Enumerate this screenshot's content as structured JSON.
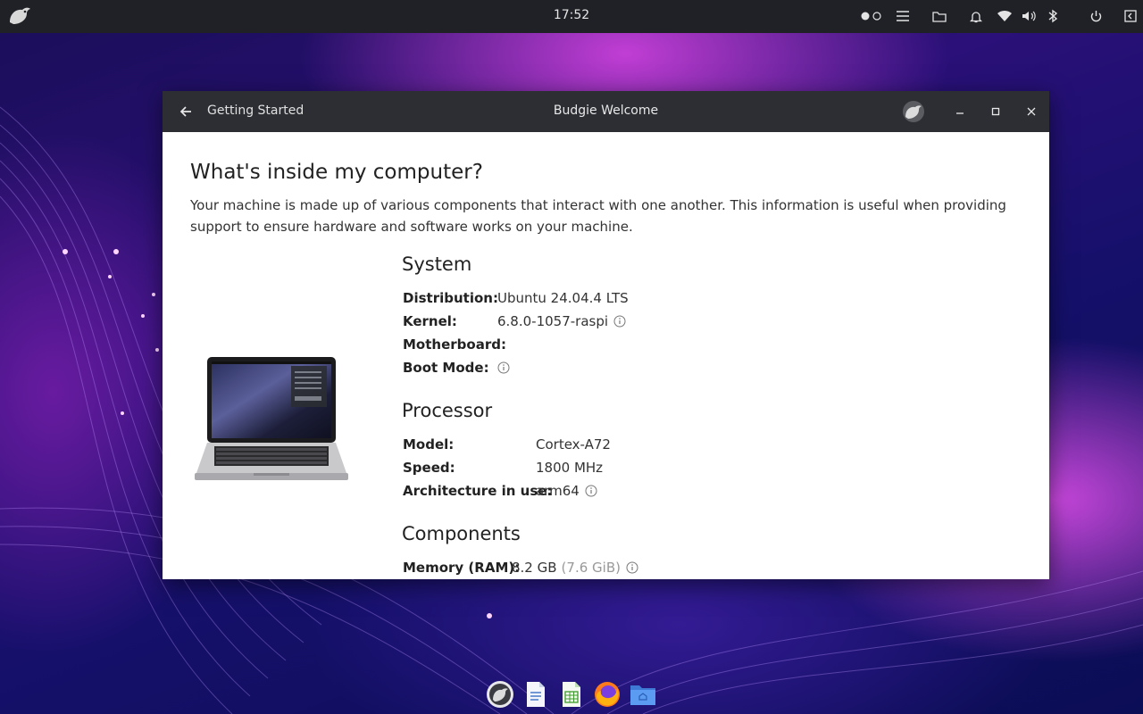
{
  "top_panel": {
    "clock": "17:52",
    "icons": [
      "budgie-logo-icon",
      "workspace-indicator-icon",
      "menu-icon",
      "folder-icon",
      "notification-bell-icon",
      "wifi-icon",
      "volume-icon",
      "bluetooth-icon",
      "power-icon",
      "sidebar-toggle-icon"
    ]
  },
  "window": {
    "back_label": "Getting Started",
    "title": "Budgie Welcome",
    "controls": [
      "minimize-icon",
      "maximize-icon",
      "close-icon"
    ]
  },
  "page": {
    "title": "What's inside my computer?",
    "description": "Your machine is made up of various components that interact with one another. This information is useful when providing support to ensure hardware and software works on your machine."
  },
  "system": {
    "title": "System",
    "distribution_label": "Distribution:",
    "distribution_value": "Ubuntu 24.04.4 LTS",
    "kernel_label": "Kernel:",
    "kernel_value": "6.8.0-1057-raspi",
    "motherboard_label": "Motherboard:",
    "motherboard_value": "'",
    "bootmode_label": "Boot Mode:",
    "bootmode_value": ""
  },
  "processor": {
    "title": "Processor",
    "model_label": "Model:",
    "model_value": "Cortex-A72",
    "speed_label": "Speed:",
    "speed_value": "1800 MHz",
    "arch_label": "Architecture in use:",
    "arch_value": "arm64"
  },
  "components": {
    "title": "Components",
    "memory_label": "Memory (RAM):",
    "memory_value": "8.2 GB",
    "memory_alt": "(7.6 GiB)"
  },
  "dock": {
    "apps": [
      "budgie-welcome-icon",
      "text-editor-icon",
      "spreadsheet-icon",
      "firefox-icon",
      "files-icon"
    ]
  },
  "colors": {
    "panel": "#1f2126",
    "titlebar": "#2c2e33",
    "window_bg": "#ffffff"
  }
}
